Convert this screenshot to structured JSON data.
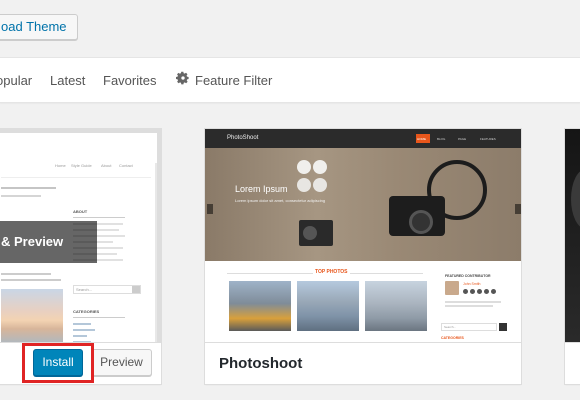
{
  "toolbar": {
    "upload_label": "oad Theme"
  },
  "filters": {
    "items": [
      {
        "label": "opular"
      },
      {
        "label": "Latest"
      },
      {
        "label": "Favorites"
      }
    ],
    "feature_filter_label": "Feature Filter",
    "feature_filter_icon": "gear-icon"
  },
  "cards": [
    {
      "overlay_label": "& Preview",
      "install_label": "Install",
      "preview_label": "Preview",
      "mini": {
        "nav": [
          "Home",
          "Style Guide",
          "About",
          "Contact"
        ],
        "about": "ABOUT",
        "search": "Search...",
        "categories": "CATEGORIES"
      }
    },
    {
      "name": "Photoshoot",
      "mini": {
        "brand": "PhotoShoot",
        "nav": [
          "HOME",
          "BLOG",
          "PAGE",
          "FEATURES"
        ],
        "hero_title": "Lorem Ipsum",
        "hero_sub": "Lorem ipsum dolor sit amet, consectetur adipiscing",
        "section": "TOP PHOTOS",
        "featured": "FEATURED CONTRIBUTOR",
        "contributor": "John Smith",
        "search": "Search...",
        "categories": "CATEGORIES"
      }
    }
  ],
  "colors": {
    "accent": "#0085ba",
    "highlight": "#e02424",
    "photo_accent": "#e8561b"
  }
}
